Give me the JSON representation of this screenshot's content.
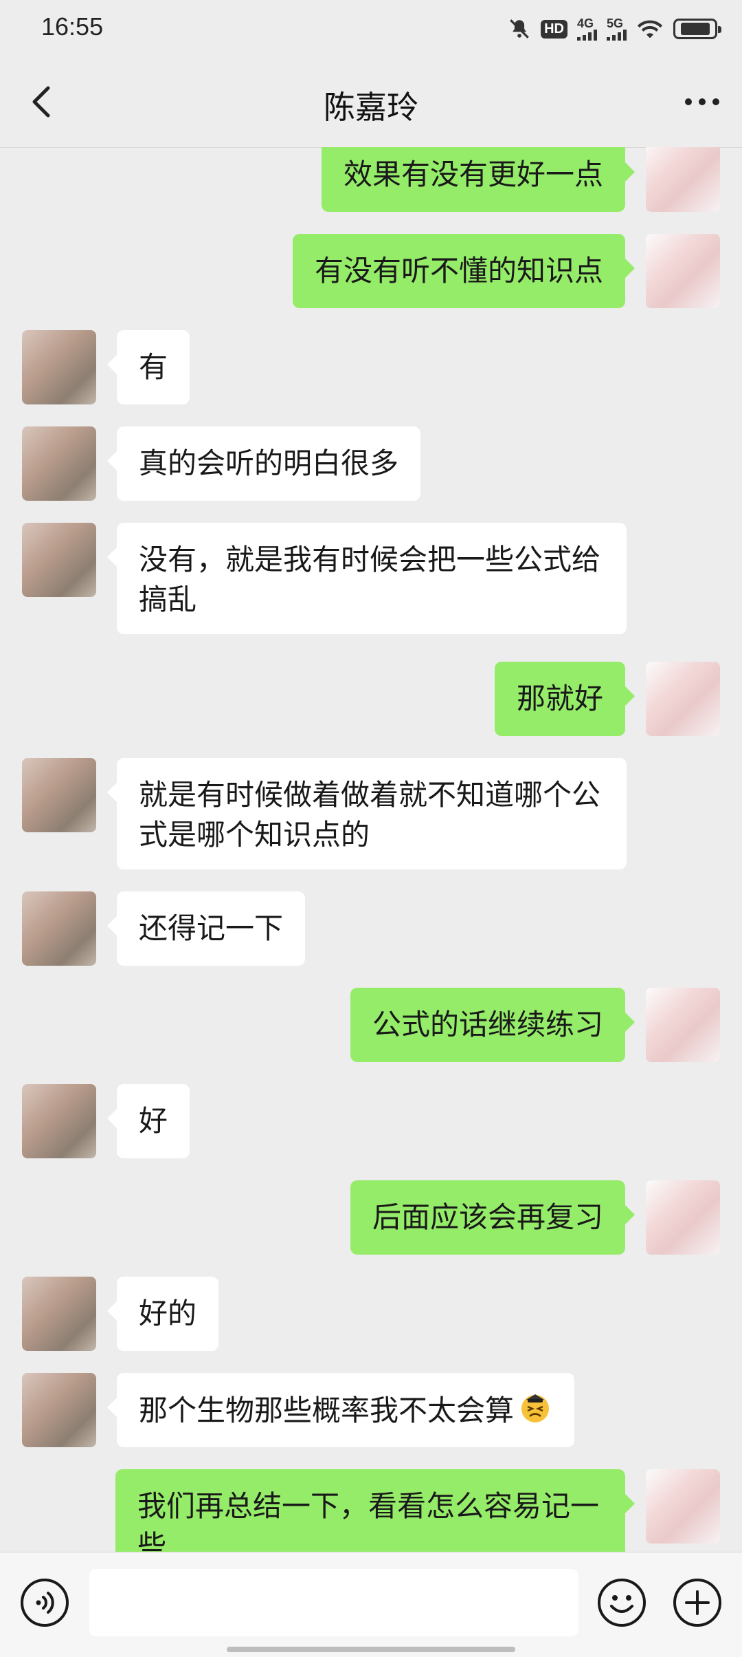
{
  "status_bar": {
    "time": "16:55",
    "hd_label": "HD",
    "net1_label": "4G",
    "net2_label": "5G"
  },
  "header": {
    "title": "陈嘉玲",
    "back_icon": "chevron-left-icon",
    "more_icon": "more-dots-icon"
  },
  "messages": [
    {
      "from": "me",
      "text": "效果有没有更好一点"
    },
    {
      "from": "me",
      "text": "有没有听不懂的知识点"
    },
    {
      "from": "her",
      "text": "有"
    },
    {
      "from": "her",
      "text": "真的会听的明白很多"
    },
    {
      "from": "her",
      "text": "没有，就是我有时候会把一些公式给搞乱"
    },
    {
      "from": "me",
      "text": "那就好"
    },
    {
      "from": "her",
      "text": "就是有时候做着做着就不知道哪个公式是哪个知识点的"
    },
    {
      "from": "her",
      "text": "还得记一下"
    },
    {
      "from": "me",
      "text": "公式的话继续练习"
    },
    {
      "from": "her",
      "text": "好"
    },
    {
      "from": "me",
      "text": "后面应该会再复习"
    },
    {
      "from": "her",
      "text": "好的"
    },
    {
      "from": "her",
      "text": "那个生物那些概率我不太会算",
      "emoji": "tired-face-icon"
    },
    {
      "from": "me",
      "text": "我们再总结一下，看看怎么容易记一些"
    }
  ],
  "input_bar": {
    "voice_icon": "voice-icon",
    "input_value": "",
    "emoji_icon": "emoji-icon",
    "plus_icon": "plus-icon"
  },
  "colors": {
    "background": "#ededed",
    "bubble_me": "#95ec69",
    "bubble_her": "#ffffff",
    "text": "#191919"
  }
}
